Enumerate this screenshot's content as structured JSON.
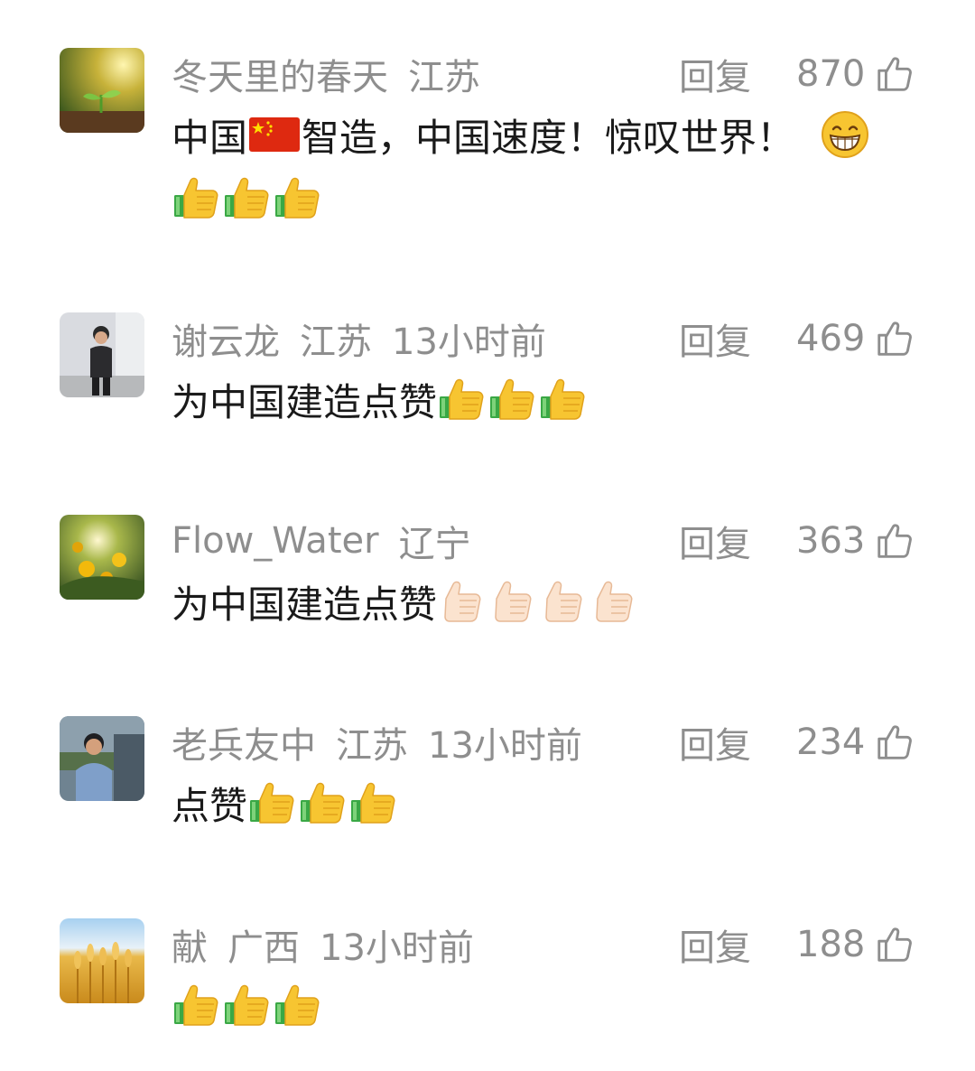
{
  "comments": [
    {
      "username": "冬天里的春天",
      "location": "江苏",
      "time": "",
      "reply_label": "回复",
      "likes": "870",
      "text_a": "中国",
      "text_b": "智造，中国速度！惊叹世界！",
      "text_c": "",
      "avatar": "sprout-photo",
      "emoji_after": [
        "grinning-face-emoji"
      ],
      "emoji_line": [
        "thumbs-up-emoji",
        "thumbs-up-emoji",
        "thumbs-up-emoji"
      ]
    },
    {
      "username": "谢云龙",
      "location": "江苏",
      "time": "13小时前",
      "reply_label": "回复",
      "likes": "469",
      "text_a": "为中国建造点赞",
      "avatar": "person-photo",
      "emoji_after": [
        "thumbs-up-emoji",
        "thumbs-up-emoji",
        "thumbs-up-emoji"
      ]
    },
    {
      "username": "Flow_Water",
      "location": "辽宁",
      "time": "",
      "reply_label": "回复",
      "likes": "363",
      "text_a": "为中国建造点赞",
      "avatar": "sunflower-photo",
      "emoji_after": [
        "thumbs-up-light-emoji",
        "thumbs-up-light-emoji",
        "thumbs-up-light-emoji",
        "thumbs-up-light-emoji"
      ]
    },
    {
      "username": "老兵友中",
      "location": "江苏",
      "time": "13小时前",
      "reply_label": "回复",
      "likes": "234",
      "text_a": "点赞",
      "avatar": "person-photo",
      "emoji_after": [
        "thumbs-up-emoji",
        "thumbs-up-emoji",
        "thumbs-up-emoji"
      ]
    },
    {
      "username": "献",
      "location": "广西",
      "time": "13小时前",
      "reply_label": "回复",
      "likes": "188",
      "text_a": "",
      "avatar": "wheat-photo",
      "emoji_line": [
        "thumbs-up-emoji",
        "thumbs-up-emoji",
        "thumbs-up-emoji"
      ]
    }
  ],
  "colors": {
    "meta_text": "#8e8e8e",
    "body_text": "#1a1a1a",
    "background": "#ffffff"
  }
}
